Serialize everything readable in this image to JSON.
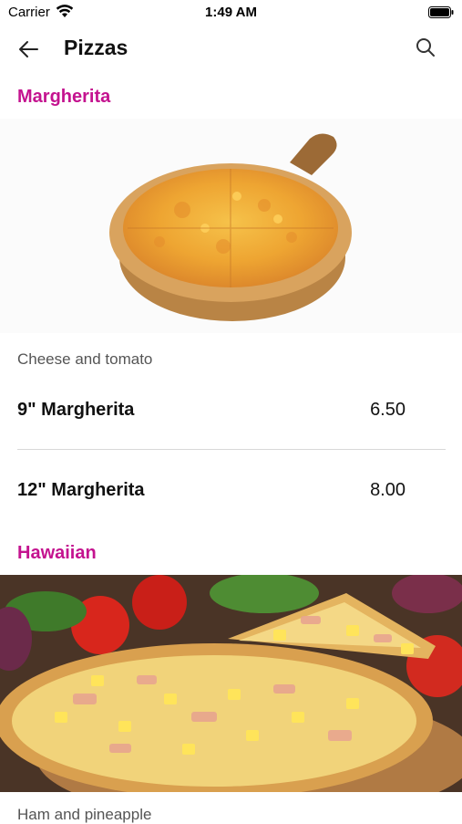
{
  "status": {
    "carrier": "Carrier",
    "time": "1:49 AM"
  },
  "nav": {
    "title": "Pizzas"
  },
  "sections": [
    {
      "title": "Margherita",
      "description": "Cheese and tomato",
      "items": [
        {
          "name": "9\" Margherita",
          "price": "6.50"
        },
        {
          "name": "12\" Margherita",
          "price": "8.00"
        }
      ]
    },
    {
      "title": "Hawaiian",
      "description": "Ham and pineapple"
    }
  ],
  "colors": {
    "accent": "#c4138f"
  },
  "icons": [
    "wifi-icon",
    "battery-icon",
    "back-arrow-icon",
    "search-icon"
  ]
}
